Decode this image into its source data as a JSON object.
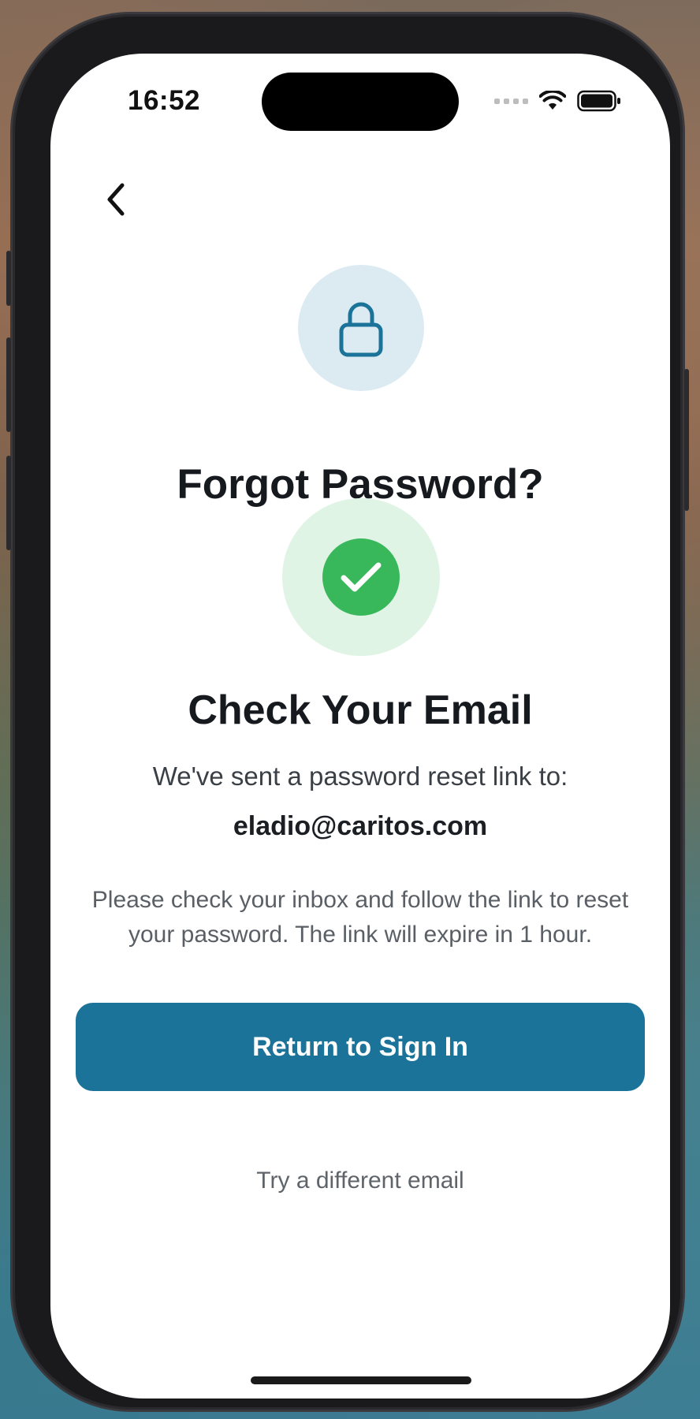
{
  "status_bar": {
    "time": "16:52",
    "icons": [
      "cellular-signal-icon",
      "wifi-icon",
      "battery-icon"
    ]
  },
  "nav": {
    "back_icon": "chevron-left-icon"
  },
  "header": {
    "icon": "lock-icon",
    "title": "Forgot Password?"
  },
  "confirmation": {
    "icon": "checkmark-icon",
    "title": "Check Your Email",
    "sent_message": "We've sent a password reset link to:",
    "email": "eladio@caritos.com",
    "info": "Please check your inbox and follow the link to reset your password. The link will expire in 1 hour."
  },
  "actions": {
    "primary_label": "Return to Sign In",
    "secondary_label": "Try a different email"
  },
  "colors": {
    "primary": "#1b7399",
    "success": "#39b85b",
    "success_bg": "#e0f4e6",
    "lock_bg": "#dcebf2",
    "lock_stroke": "#1b7399"
  }
}
